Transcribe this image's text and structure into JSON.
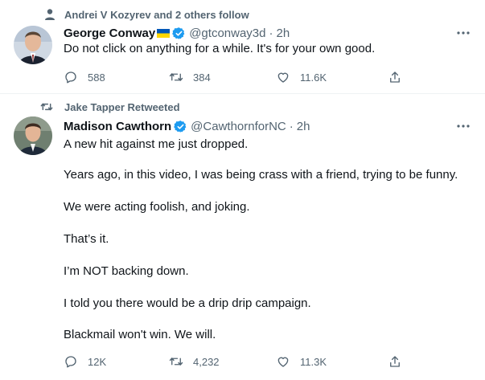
{
  "tweets": [
    {
      "social_context": "Andrei V Kozyrev and 2 others follow",
      "social_icon": "person-icon",
      "name": "George Conway",
      "flag": "ukraine-flag",
      "handle": "@gtconway3d",
      "separator": "·",
      "time": "2h",
      "lines": [
        "Do not click on anything for a while. It's for your own good."
      ],
      "stats": {
        "replies": "588",
        "retweets": "384",
        "likes": "11.6K"
      }
    },
    {
      "social_context": "Jake Tapper Retweeted",
      "social_icon": "retweet-icon",
      "name": "Madison Cawthorn",
      "handle": "@CawthornforNC",
      "separator": "·",
      "time": "2h",
      "lines": [
        "A new hit against me just dropped.",
        "Years ago, in this video, I was being crass with a friend, trying to be funny.",
        "We were acting foolish, and joking.",
        "That’s it.",
        "I’m NOT backing down.",
        "I told you there would be a drip drip campaign.",
        "Blackmail won't win. We will."
      ],
      "stats": {
        "replies": "12K",
        "retweets": "4,232",
        "likes": "11.3K"
      }
    }
  ],
  "colors": {
    "verified": "#1d9bf0",
    "secondary_text": "#536471",
    "divider": "#eff3f4"
  }
}
